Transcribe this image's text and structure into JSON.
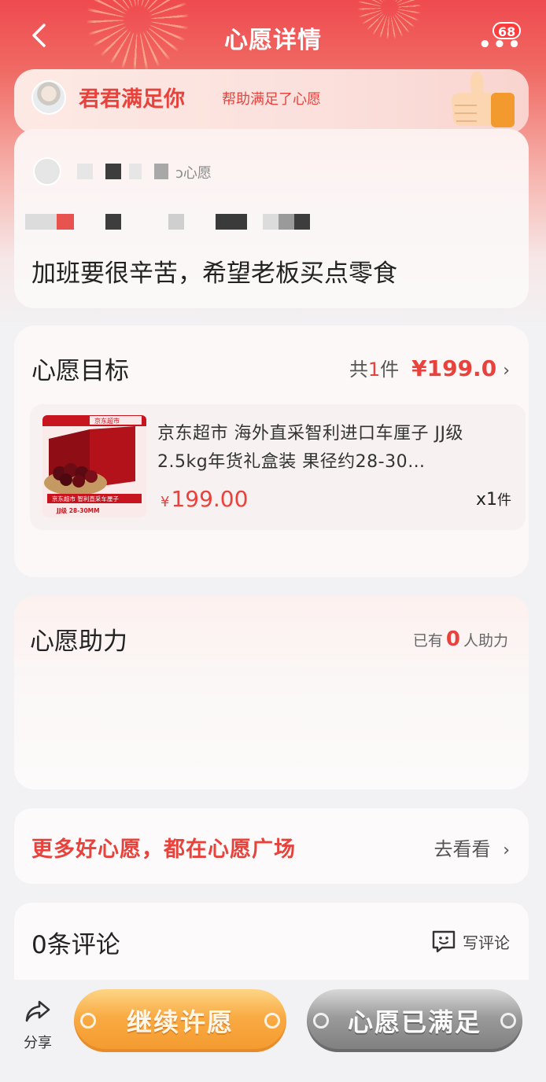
{
  "header": {
    "title": "心愿详情",
    "back_icon": "back-arrow-icon",
    "more_icon": "more-dots-icon",
    "message_badge": "68"
  },
  "helper": {
    "name": "君君满足你",
    "action_text": "帮助满足了心愿",
    "thumb_icon": "thumbs-up-icon"
  },
  "wish": {
    "owner_suffix": "ɔ心愿",
    "text": "加班要很辛苦，希望老板买点零食"
  },
  "goal": {
    "title": "心愿目标",
    "count_prefix": "共",
    "count": "1",
    "count_unit": "件",
    "total_price": "¥199.0",
    "product": {
      "name": "京东超市 海外直采智利进口车厘子 JJ级2.5kg年货礼盒装 果径约28-30…",
      "yen": "¥",
      "price": "199.00",
      "qty_prefix": "x",
      "qty": "1",
      "qty_unit": "件",
      "image_store_label": "京东超市",
      "image_caption": "京东超市 智利直采车厘子",
      "image_spec": "JJ级 28-30MM"
    }
  },
  "support": {
    "title": "心愿助力",
    "count_prefix": "已有",
    "count": "0",
    "count_suffix": "人助力"
  },
  "plaza": {
    "text": "更多好心愿，都在心愿广场",
    "link": "去看看"
  },
  "comments": {
    "title": "0条评论",
    "write_label": "写评论"
  },
  "bottom": {
    "share_label": "分享",
    "continue_label": "继续许愿",
    "done_label": "心愿已满足"
  },
  "colors": {
    "accent_red": "#e8423c",
    "header_red": "#ef4a4f",
    "continue_orange": "#f9aa42",
    "done_gray": "#9a9a9a"
  }
}
